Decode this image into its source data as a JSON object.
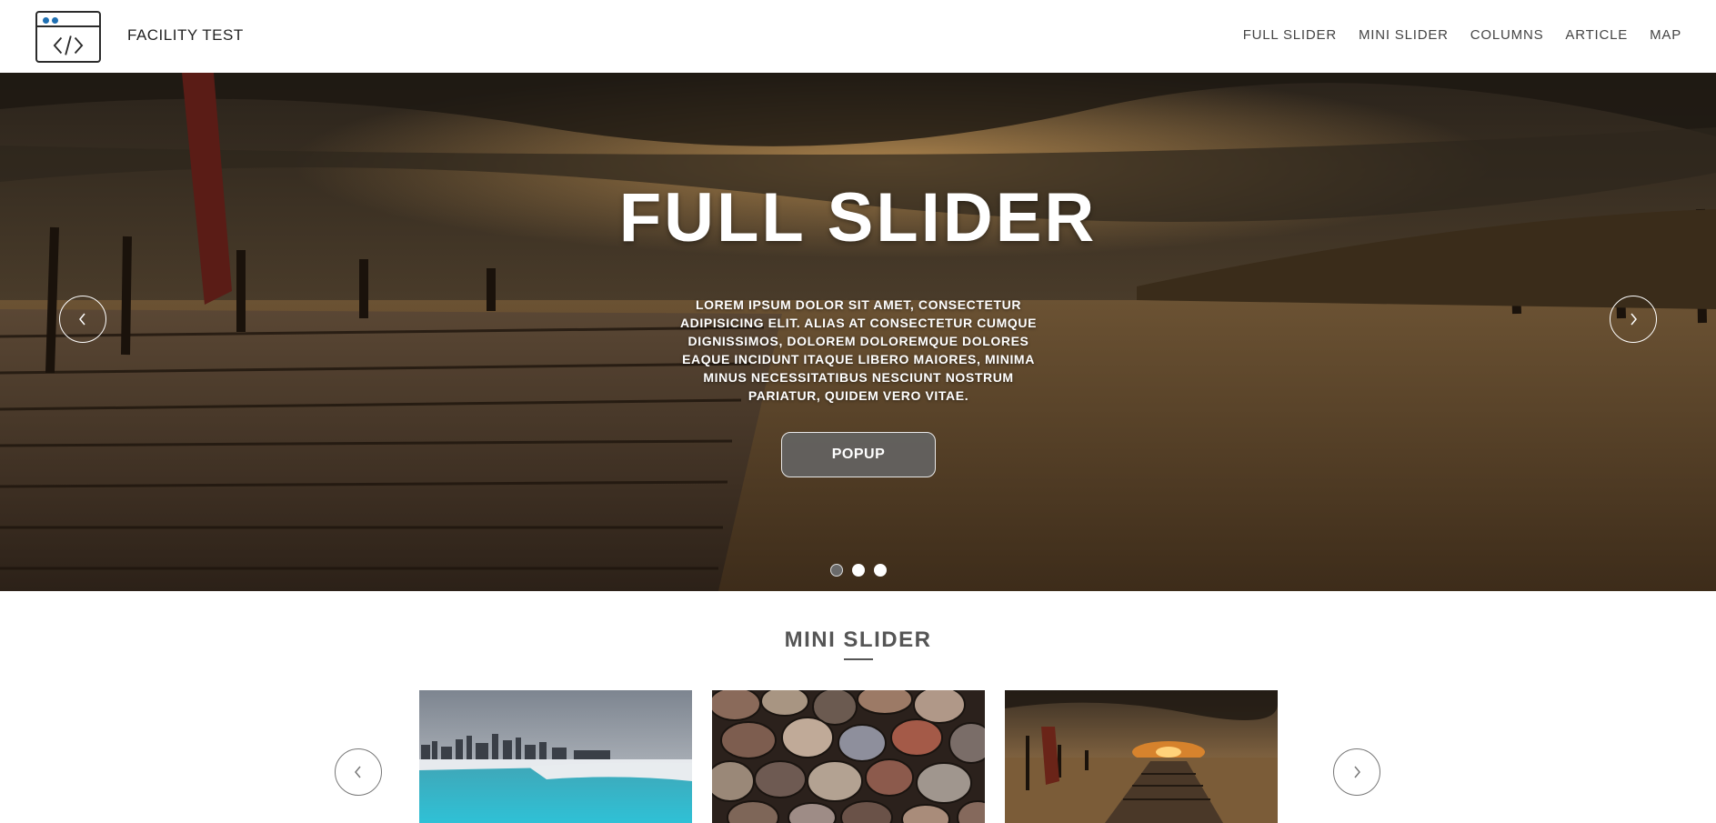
{
  "header": {
    "brand": "FACILITY TEST",
    "nav": [
      "FULL SLIDER",
      "MINI SLIDER",
      "COLUMNS",
      "ARTICLE",
      "MAP"
    ]
  },
  "hero": {
    "title": "FULL SLIDER",
    "text": "LOREM IPSUM DOLOR SIT AMET, CONSECTETUR ADIPISICING ELIT. ALIAS AT CONSECTETUR CUMQUE DIGNISSIMOS, DOLOREM DOLOREMQUE DOLORES EAQUE INCIDUNT ITAQUE LIBERO MAIORES, MINIMA MINUS NECESSITATIBUS NESCIUNT NOSTRUM PARIATUR, QUIDEM VERO VITAE.",
    "button": "POPUP",
    "slides_total": 3,
    "active_slide": 1
  },
  "mini_slider": {
    "title": "MINI SLIDER"
  },
  "colors": {
    "nav_text": "#444444",
    "section_title": "#555555",
    "active_dot": "#6a6a6a"
  }
}
